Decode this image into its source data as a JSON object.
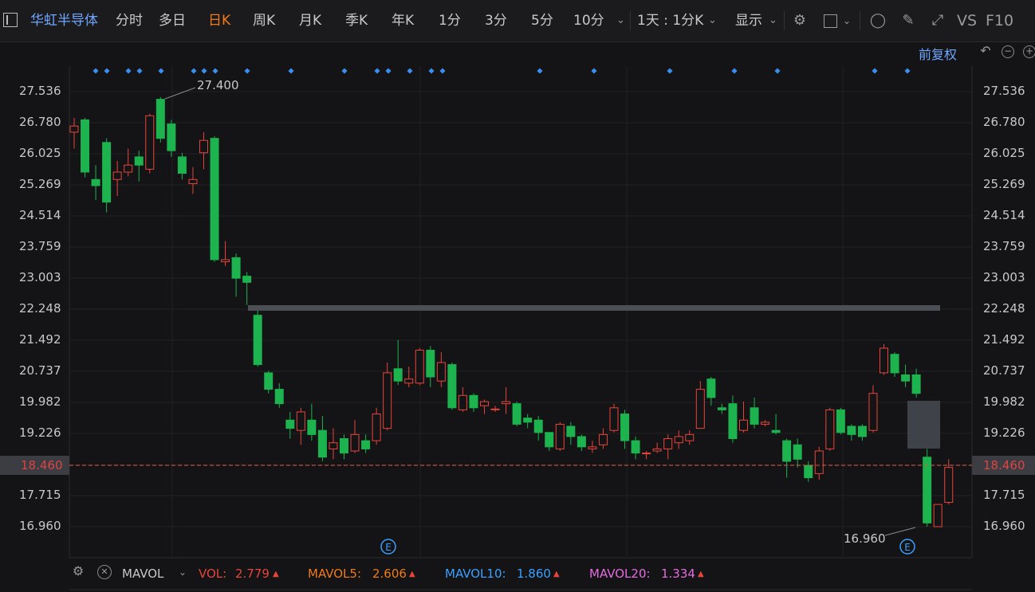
{
  "toolbar": {
    "stock_name": "华虹半导体",
    "periods": [
      "分时",
      "多日",
      "日K",
      "周K",
      "月K",
      "季K",
      "年K",
      "1分",
      "3分",
      "5分",
      "10分"
    ],
    "active_period": "日K",
    "range_label": "1天 : 1分K",
    "display_label": "显示",
    "vs_label": "VS",
    "f10_label": "F10"
  },
  "subheader": {
    "adjust_label": "前复权"
  },
  "colors": {
    "up": "#e8443a",
    "down": "#1db34f",
    "accent": "#f07a1a",
    "link": "#6ea6ff",
    "mavol10": "#3aa0ff",
    "mavol20": "#e56be0"
  },
  "axis": {
    "y_labels": [
      "27.536",
      "26.780",
      "26.025",
      "25.269",
      "24.514",
      "23.759",
      "23.003",
      "22.248",
      "21.492",
      "20.737",
      "19.982",
      "19.226",
      "18.460",
      "17.715",
      "16.960"
    ],
    "current_price": "18.460"
  },
  "annotations": {
    "high_label": "27.400",
    "low_label": "16.960",
    "event_marker": "E"
  },
  "chart_data": {
    "type": "candlestick",
    "ylim": [
      16.6,
      27.9
    ],
    "series": [
      {
        "o": 26.55,
        "c": 26.7,
        "h": 26.9,
        "l": 26.15
      },
      {
        "o": 26.85,
        "c": 25.58,
        "h": 26.9,
        "l": 25.45
      },
      {
        "o": 25.4,
        "c": 25.25,
        "h": 25.75,
        "l": 24.9
      },
      {
        "o": 26.3,
        "c": 24.85,
        "h": 26.4,
        "l": 24.6
      },
      {
        "o": 25.4,
        "c": 25.58,
        "h": 25.85,
        "l": 25.0
      },
      {
        "o": 25.58,
        "c": 25.75,
        "h": 26.15,
        "l": 25.48
      },
      {
        "o": 25.95,
        "c": 25.75,
        "h": 26.1,
        "l": 25.35
      },
      {
        "o": 25.65,
        "c": 26.95,
        "h": 27.0,
        "l": 25.55
      },
      {
        "o": 27.35,
        "c": 26.4,
        "h": 27.4,
        "l": 26.3
      },
      {
        "o": 26.75,
        "c": 26.1,
        "h": 26.85,
        "l": 25.95
      },
      {
        "o": 25.95,
        "c": 25.55,
        "h": 26.05,
        "l": 25.4
      },
      {
        "o": 25.3,
        "c": 25.4,
        "h": 25.7,
        "l": 25.05
      },
      {
        "o": 26.05,
        "c": 26.35,
        "h": 26.55,
        "l": 25.65
      },
      {
        "o": 26.4,
        "c": 23.45,
        "h": 26.45,
        "l": 23.4
      },
      {
        "o": 23.4,
        "c": 23.45,
        "h": 23.9,
        "l": 23.3
      },
      {
        "o": 23.5,
        "c": 23.0,
        "h": 23.6,
        "l": 22.55
      },
      {
        "o": 23.05,
        "c": 22.9,
        "h": 23.15,
        "l": 22.35
      },
      {
        "o": 22.1,
        "c": 20.9,
        "h": 22.3,
        "l": 20.85
      },
      {
        "o": 20.7,
        "c": 20.3,
        "h": 20.75,
        "l": 20.2
      },
      {
        "o": 20.3,
        "c": 19.95,
        "h": 20.45,
        "l": 19.85
      },
      {
        "o": 19.55,
        "c": 19.35,
        "h": 19.75,
        "l": 19.1
      },
      {
        "o": 19.3,
        "c": 19.75,
        "h": 19.85,
        "l": 18.95
      },
      {
        "o": 19.55,
        "c": 19.2,
        "h": 19.95,
        "l": 19.05
      },
      {
        "o": 19.3,
        "c": 18.65,
        "h": 19.65,
        "l": 18.55
      },
      {
        "o": 18.85,
        "c": 19.0,
        "h": 19.35,
        "l": 18.6
      },
      {
        "o": 19.1,
        "c": 18.75,
        "h": 19.2,
        "l": 18.6
      },
      {
        "o": 18.8,
        "c": 19.2,
        "h": 19.55,
        "l": 18.75
      },
      {
        "o": 19.05,
        "c": 18.85,
        "h": 19.2,
        "l": 18.75
      },
      {
        "o": 19.05,
        "c": 19.7,
        "h": 19.85,
        "l": 18.95
      },
      {
        "o": 19.35,
        "c": 20.7,
        "h": 20.95,
        "l": 19.3
      },
      {
        "o": 20.8,
        "c": 20.5,
        "h": 21.5,
        "l": 20.4
      },
      {
        "o": 20.45,
        "c": 20.55,
        "h": 20.85,
        "l": 20.35
      },
      {
        "o": 20.45,
        "c": 21.25,
        "h": 21.3,
        "l": 20.4
      },
      {
        "o": 21.25,
        "c": 20.6,
        "h": 21.35,
        "l": 20.35
      },
      {
        "o": 20.5,
        "c": 20.95,
        "h": 21.2,
        "l": 20.35
      },
      {
        "o": 20.9,
        "c": 19.85,
        "h": 20.95,
        "l": 19.8
      },
      {
        "o": 19.8,
        "c": 20.15,
        "h": 20.35,
        "l": 19.75
      },
      {
        "o": 20.15,
        "c": 19.85,
        "h": 20.2,
        "l": 19.75
      },
      {
        "o": 19.9,
        "c": 20.0,
        "h": 20.05,
        "l": 19.7
      },
      {
        "o": 19.82,
        "c": 19.82,
        "h": 19.9,
        "l": 19.75
      },
      {
        "o": 19.95,
        "c": 20.0,
        "h": 20.35,
        "l": 19.7
      },
      {
        "o": 19.95,
        "c": 19.45,
        "h": 20.0,
        "l": 19.4
      },
      {
        "o": 19.6,
        "c": 19.5,
        "h": 19.7,
        "l": 19.35
      },
      {
        "o": 19.55,
        "c": 19.25,
        "h": 19.65,
        "l": 19.05
      },
      {
        "o": 19.25,
        "c": 18.9,
        "h": 19.25,
        "l": 18.8
      },
      {
        "o": 18.85,
        "c": 19.45,
        "h": 19.5,
        "l": 18.8
      },
      {
        "o": 19.4,
        "c": 19.15,
        "h": 19.5,
        "l": 18.95
      },
      {
        "o": 19.15,
        "c": 18.9,
        "h": 19.2,
        "l": 18.8
      },
      {
        "o": 18.85,
        "c": 18.9,
        "h": 19.05,
        "l": 18.75
      },
      {
        "o": 18.95,
        "c": 19.2,
        "h": 19.35,
        "l": 18.85
      },
      {
        "o": 19.3,
        "c": 19.85,
        "h": 19.95,
        "l": 19.25
      },
      {
        "o": 19.7,
        "c": 19.05,
        "h": 19.8,
        "l": 18.85
      },
      {
        "o": 19.05,
        "c": 18.75,
        "h": 19.15,
        "l": 18.6
      },
      {
        "o": 18.75,
        "c": 18.75,
        "h": 18.8,
        "l": 18.6
      },
      {
        "o": 18.8,
        "c": 18.85,
        "h": 19.0,
        "l": 18.75
      },
      {
        "o": 18.85,
        "c": 19.1,
        "h": 19.2,
        "l": 18.6
      },
      {
        "o": 19.0,
        "c": 19.15,
        "h": 19.3,
        "l": 18.85
      },
      {
        "o": 19.05,
        "c": 19.2,
        "h": 19.3,
        "l": 18.95
      },
      {
        "o": 19.35,
        "c": 20.3,
        "h": 20.5,
        "l": 19.35
      },
      {
        "o": 20.55,
        "c": 20.1,
        "h": 20.6,
        "l": 19.9
      },
      {
        "o": 19.85,
        "c": 19.8,
        "h": 19.95,
        "l": 19.7
      },
      {
        "o": 19.95,
        "c": 19.1,
        "h": 20.15,
        "l": 19.0
      },
      {
        "o": 19.3,
        "c": 19.55,
        "h": 20.0,
        "l": 19.25
      },
      {
        "o": 19.85,
        "c": 19.45,
        "h": 20.1,
        "l": 19.35
      },
      {
        "o": 19.45,
        "c": 19.5,
        "h": 19.55,
        "l": 19.4
      },
      {
        "o": 19.3,
        "c": 19.25,
        "h": 19.7,
        "l": 19.2
      },
      {
        "o": 19.05,
        "c": 18.55,
        "h": 19.1,
        "l": 18.15
      },
      {
        "o": 18.95,
        "c": 18.6,
        "h": 19.1,
        "l": 18.4
      },
      {
        "o": 18.45,
        "c": 18.15,
        "h": 18.55,
        "l": 18.05
      },
      {
        "o": 18.25,
        "c": 18.8,
        "h": 18.9,
        "l": 18.1
      },
      {
        "o": 18.85,
        "c": 19.8,
        "h": 19.85,
        "l": 18.8
      },
      {
        "o": 19.8,
        "c": 19.25,
        "h": 19.85,
        "l": 19.2
      },
      {
        "o": 19.4,
        "c": 19.2,
        "h": 19.45,
        "l": 19.05
      },
      {
        "o": 19.4,
        "c": 19.15,
        "h": 19.45,
        "l": 19.05
      },
      {
        "o": 19.3,
        "c": 20.2,
        "h": 20.4,
        "l": 19.25
      },
      {
        "o": 20.7,
        "c": 21.3,
        "h": 21.4,
        "l": 20.65
      },
      {
        "o": 21.15,
        "c": 20.7,
        "h": 21.2,
        "l": 20.6
      },
      {
        "o": 20.65,
        "c": 20.5,
        "h": 20.9,
        "l": 20.35
      },
      {
        "o": 20.65,
        "c": 20.2,
        "h": 20.8,
        "l": 20.1
      },
      {
        "o": 18.65,
        "c": 17.05,
        "h": 18.85,
        "l": 16.96
      },
      {
        "o": 16.96,
        "c": 17.5,
        "h": 17.5,
        "l": 16.96
      },
      {
        "o": 17.55,
        "c": 18.4,
        "h": 18.6,
        "l": 17.5
      }
    ]
  },
  "bottom": {
    "indicator": "MAVOL",
    "vol_label": "VOL:",
    "vol_value": "2.779",
    "mavol5_label": "MAVOL5:",
    "mavol5_value": "2.606",
    "mavol10_label": "MAVOL10:",
    "mavol10_value": "1.860",
    "mavol20_label": "MAVOL20:",
    "mavol20_value": "1.334"
  }
}
